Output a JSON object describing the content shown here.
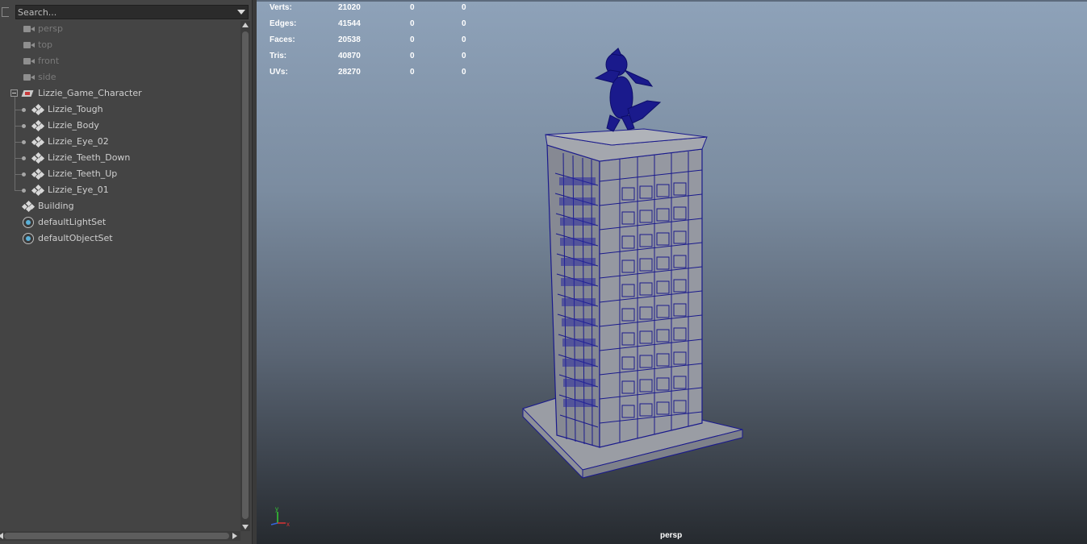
{
  "outliner": {
    "search_placeholder": "Search...",
    "items": [
      {
        "label": "persp",
        "type": "camera"
      },
      {
        "label": "top",
        "type": "camera"
      },
      {
        "label": "front",
        "type": "camera"
      },
      {
        "label": "side",
        "type": "camera"
      },
      {
        "label": "Lizzie_Game_Character",
        "type": "group"
      },
      {
        "label": "Lizzie_Tough",
        "type": "mesh"
      },
      {
        "label": "Lizzie_Body",
        "type": "mesh"
      },
      {
        "label": "Lizzie_Eye_02",
        "type": "mesh"
      },
      {
        "label": "Lizzie_Teeth_Down",
        "type": "mesh"
      },
      {
        "label": "Lizzie_Teeth_Up",
        "type": "mesh"
      },
      {
        "label": "Lizzie_Eye_01",
        "type": "mesh"
      },
      {
        "label": "Building",
        "type": "mesh"
      },
      {
        "label": "defaultLightSet",
        "type": "set"
      },
      {
        "label": "defaultObjectSet",
        "type": "set"
      }
    ]
  },
  "viewport": {
    "stats": [
      {
        "label": "Verts:",
        "total": "21020",
        "selected": "0",
        "component": "0"
      },
      {
        "label": "Edges:",
        "total": "41544",
        "selected": "0",
        "component": "0"
      },
      {
        "label": "Faces:",
        "total": "20538",
        "selected": "0",
        "component": "0"
      },
      {
        "label": "Tris:",
        "total": "40870",
        "selected": "0",
        "component": "0"
      },
      {
        "label": "UVs:",
        "total": "28270",
        "selected": "0",
        "component": "0"
      }
    ],
    "camera": "persp",
    "axis": {
      "y": "y",
      "x": "x"
    },
    "colors": {
      "wireframe": "#1a1a8c",
      "building": "#8a8d96",
      "bg_top": "#8ea2b9",
      "bg_bottom": "#262a2f"
    }
  }
}
